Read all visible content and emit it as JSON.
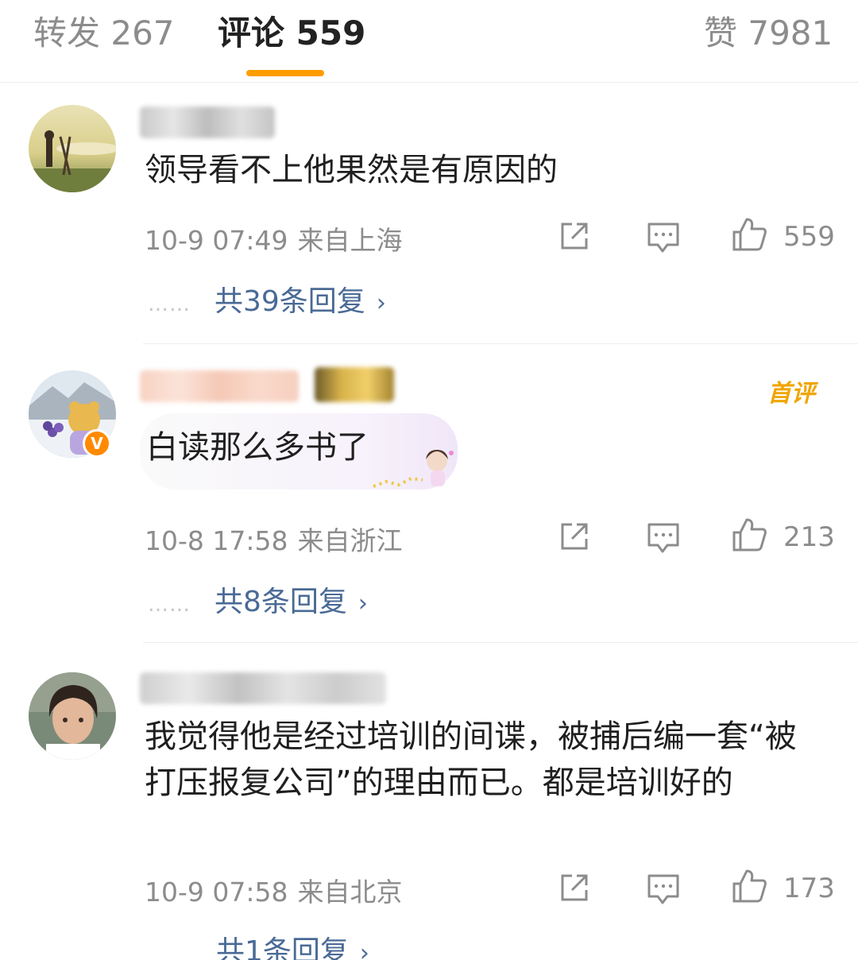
{
  "tabs": [
    {
      "label": "转发 267"
    },
    {
      "label": "评论 559"
    },
    {
      "label": "赞 7981"
    }
  ],
  "accent_color": "#ff9d00",
  "link_color": "#4a6a95",
  "comments": [
    {
      "text": "领导看不上他果然是有原因的",
      "time": "10-9 07:49",
      "location": "来自上海",
      "likes": "559",
      "replies": "共39条回复",
      "reply_dots": "……"
    },
    {
      "text": "白读那么多书了",
      "time": "10-8 17:58",
      "location": "来自浙江",
      "likes": "213",
      "replies": "共8条回复",
      "reply_dots": "……",
      "tag": "首评"
    },
    {
      "text": "我觉得他是经过培训的间谍，被捕后编一套“被打压报复公司”的理由而已。都是培训好的",
      "time": "10-9 07:58",
      "location": "来自北京",
      "likes": "173",
      "replies": "共1条回复"
    }
  ],
  "icons": [
    "share-icon",
    "comment-icon",
    "like-icon",
    "chevron-right-icon",
    "verified-badge-icon"
  ]
}
